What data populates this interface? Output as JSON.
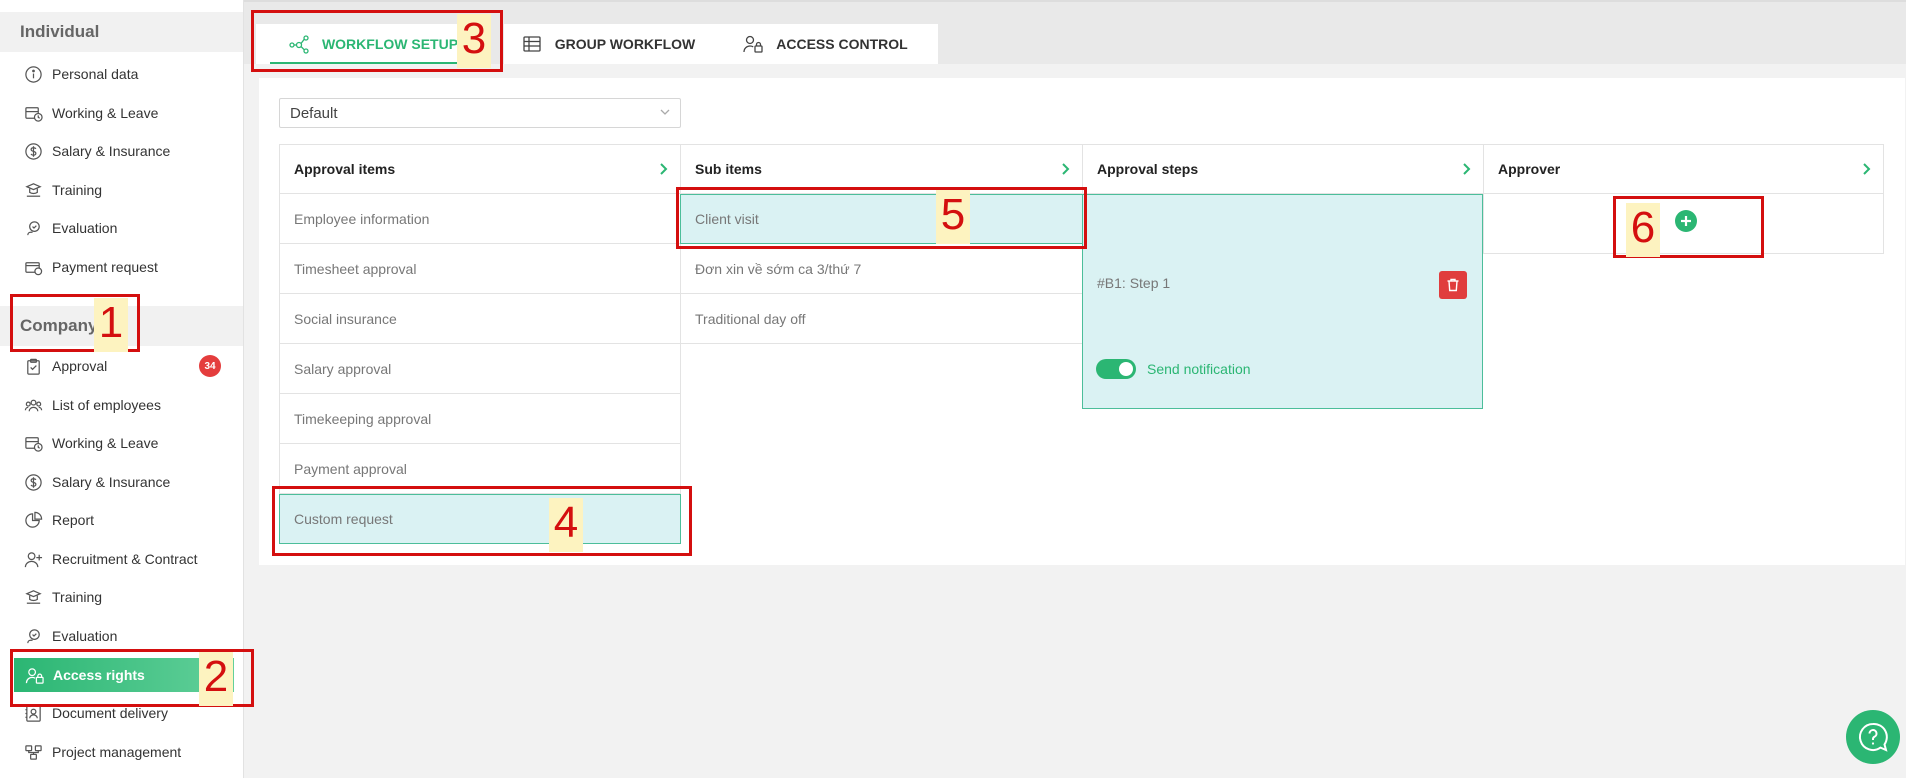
{
  "sidebar": {
    "sections": [
      {
        "title": "Individual"
      },
      {
        "title": "Company"
      }
    ],
    "individual_items": [
      {
        "label": "Personal data",
        "icon": "info-icon"
      },
      {
        "label": "Working & Leave",
        "icon": "calendar-clock-icon"
      },
      {
        "label": "Salary & Insurance",
        "icon": "dollar-icon"
      },
      {
        "label": "Training",
        "icon": "training-icon"
      },
      {
        "label": "Evaluation",
        "icon": "evaluation-icon"
      },
      {
        "label": "Payment request",
        "icon": "payment-icon"
      }
    ],
    "company_items": [
      {
        "label": "Approval",
        "icon": "clipboard-check-icon",
        "badge": "34"
      },
      {
        "label": "List of employees",
        "icon": "users-icon"
      },
      {
        "label": "Working & Leave",
        "icon": "calendar-clock-icon"
      },
      {
        "label": "Salary & Insurance",
        "icon": "dollar-icon"
      },
      {
        "label": "Report",
        "icon": "pie-chart-icon"
      },
      {
        "label": "Recruitment & Contract",
        "icon": "user-plus-icon"
      },
      {
        "label": "Training",
        "icon": "training-icon"
      },
      {
        "label": "Evaluation",
        "icon": "evaluation-icon"
      },
      {
        "label": "Access rights",
        "icon": "user-lock-icon",
        "active": true
      },
      {
        "label": "Document delivery",
        "icon": "contact-card-icon"
      },
      {
        "label": "Project management",
        "icon": "project-icon"
      }
    ]
  },
  "tabs": [
    {
      "label": "WORKFLOW SETUP",
      "icon": "workflow-icon",
      "active": true
    },
    {
      "label": "GROUP WORKFLOW",
      "icon": "table-icon"
    },
    {
      "label": "ACCESS CONTROL",
      "icon": "user-lock-icon"
    }
  ],
  "workflow_select": {
    "value": "Default"
  },
  "columns": {
    "approval_items": {
      "header": "Approval items",
      "rows": [
        "Employee information",
        "Timesheet approval",
        "Social insurance",
        "Salary approval",
        "Timekeeping approval",
        "Payment approval",
        "Custom request"
      ],
      "selected": "Custom request"
    },
    "sub_items": {
      "header": "Sub items",
      "rows": [
        "Client visit",
        "Đơn xin về sớm ca 3/thứ 7",
        "Traditional day off"
      ],
      "selected": "Client visit"
    },
    "approval_steps": {
      "header": "Approval steps",
      "step_label": "#B1: Step 1",
      "notification_label": "Send notification",
      "notification_on": true
    },
    "approver": {
      "header": "Approver"
    }
  },
  "annotations": [
    "1",
    "2",
    "3",
    "4",
    "5",
    "6"
  ],
  "colors": {
    "accent": "#2bb673",
    "selected_bg": "#daf2f3",
    "danger": "#e03d3d",
    "annotation": "#d40f0f"
  }
}
